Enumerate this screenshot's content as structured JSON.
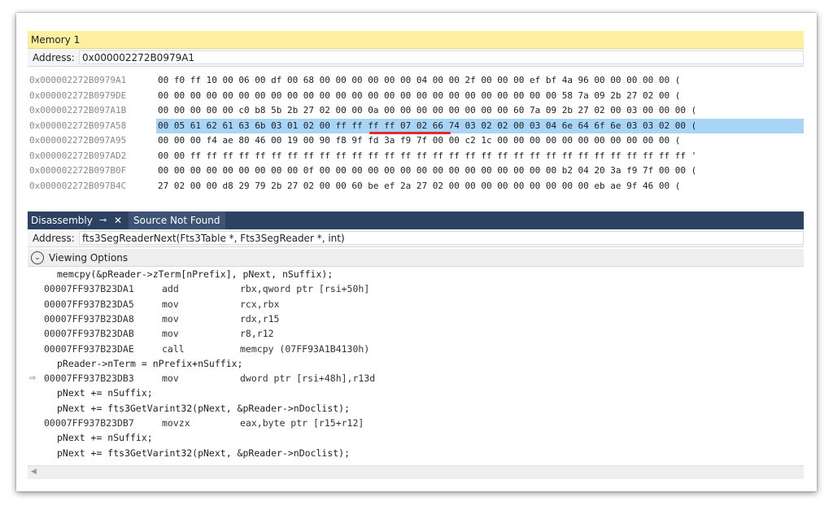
{
  "memory": {
    "title": "Memory 1",
    "address_label": "Address:",
    "address_value": "0x000002272B0979A1",
    "rows": [
      {
        "addr": "0x000002272B0979A1",
        "bytes": "00 f0 ff 10 00 06 00 df 00 68 00 00 00 00 00 00 04 00 00 2f 00 00 00 ef bf 4a 96 00 00 00 00 00 ("
      },
      {
        "addr": "0x000002272B0979DE",
        "bytes": "00 00 00 00 00 00 00 00 00 00 00 00 00 00 00 00 00 00 00 00 00 00 00 00 00 58 7a 09 2b 27 02 00 ("
      },
      {
        "addr": "0x000002272B097A1B",
        "bytes": "00 00 00 00 00 c0 b8 5b 2b 27 02 00 00 0a 00 00 00 00 00 00 00 00 60 7a 09 2b 27 02 00 03 00 00 00 ("
      },
      {
        "addr": "0x000002272B097A58",
        "bytes": "00 05 61 62 61 63 6b 03 01 02 00 ff ff ff ff 07 02 66 74 03 02 02 00 03 04 6e 64 6f 6e 03 03 02 00 ("
      },
      {
        "addr": "0x000002272B097A95",
        "bytes": "00 00 00 f4 ae 80 46 00 19 00 90 f8 9f fd 3a f9 7f 00 00 c2 1c 00 00 00 00 00 00 00 00 00 00 00 ("
      },
      {
        "addr": "0x000002272B097AD2",
        "bytes": "00 00 ff ff ff ff ff ff ff ff ff ff ff ff ff ff ff ff ff ff ff ff ff ff ff ff ff ff ff ff ff ff ff '"
      },
      {
        "addr": "0x000002272B097B0F",
        "bytes": "00 00 00 00 00 00 00 00 00 0f 00 00 00 00 00 00 00 00 00 00 00 00 00 00 00 b2 04 20 3a f9 7f 00 00 ("
      },
      {
        "addr": "0x000002272B097B4C",
        "bytes": "27 02 00 00 d8 29 79 2b 27 02 00 00 60 be ef 2a 27 02 00 00 00 00 00 00 00 00 00 eb ae 9f 46 00 ("
      }
    ],
    "selected_row": 3
  },
  "disassembly": {
    "tab_label": "Disassembly",
    "pin_icon": "⊸",
    "close_icon": "✕",
    "second_tab": "Source Not Found",
    "address_label": "Address:",
    "address_value": "fts3SegReaderNext(Fts3Table *, Fts3SegReader *, int)",
    "viewing_options": "Viewing Options",
    "lines": [
      {
        "type": "src",
        "text": "memcpy(&pReader->zTerm[nPrefix], pNext, nSuffix);"
      },
      {
        "type": "asm",
        "addr": "00007FF937B23DA1",
        "mn": "add",
        "op": "rbx,qword ptr [rsi+50h]"
      },
      {
        "type": "asm",
        "addr": "00007FF937B23DA5",
        "mn": "mov",
        "op": "rcx,rbx"
      },
      {
        "type": "asm",
        "addr": "00007FF937B23DA8",
        "mn": "mov",
        "op": "rdx,r15"
      },
      {
        "type": "asm",
        "addr": "00007FF937B23DAB",
        "mn": "mov",
        "op": "r8,r12"
      },
      {
        "type": "asm",
        "addr": "00007FF937B23DAE",
        "mn": "call",
        "op": "memcpy (07FF93A1B4130h)"
      },
      {
        "type": "src",
        "text": "pReader->nTerm = nPrefix+nSuffix;"
      },
      {
        "type": "asm",
        "addr": "00007FF937B23DB3",
        "mn": "mov",
        "op": "dword ptr [rsi+48h],r13d",
        "current": true
      },
      {
        "type": "src",
        "text": "pNext += nSuffix;"
      },
      {
        "type": "src",
        "text": "pNext += fts3GetVarint32(pNext, &pReader->nDoclist);"
      },
      {
        "type": "asm",
        "addr": "00007FF937B23DB7",
        "mn": "movzx",
        "op": "eax,byte ptr [r15+r12]"
      },
      {
        "type": "src",
        "text": "pNext += nSuffix;"
      },
      {
        "type": "src",
        "text": "pNext += fts3GetVarint32(pNext, &pReader->nDoclist);"
      }
    ],
    "current_arrow": "⇨",
    "scroll_left": "◀"
  }
}
